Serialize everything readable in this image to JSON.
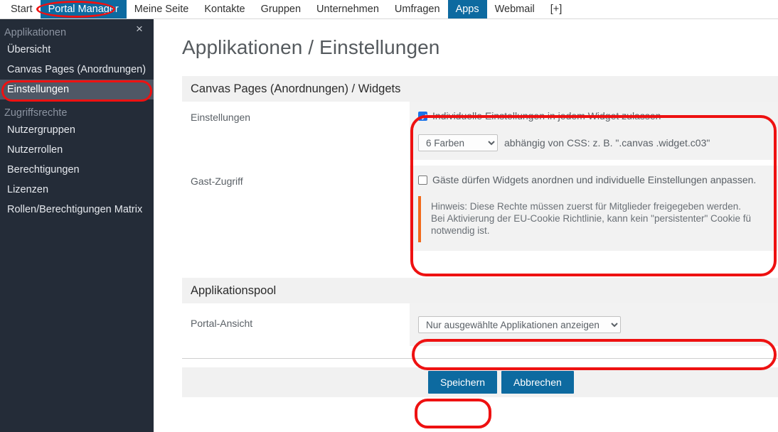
{
  "topnav": {
    "items": [
      {
        "label": "Start",
        "active": false
      },
      {
        "label": "Portal Manager",
        "active": true
      },
      {
        "label": "Meine Seite",
        "active": false
      },
      {
        "label": "Kontakte",
        "active": false
      },
      {
        "label": "Gruppen",
        "active": false
      },
      {
        "label": "Unternehmen",
        "active": false
      },
      {
        "label": "Umfragen",
        "active": false
      },
      {
        "label": "Apps",
        "active": true
      },
      {
        "label": "Webmail",
        "active": false
      },
      {
        "label": "[+]",
        "active": false
      }
    ]
  },
  "sidebar": {
    "close_icon": "×",
    "groups": [
      {
        "title": "Applikationen",
        "items": [
          {
            "label": "Übersicht",
            "active": false
          },
          {
            "label": "Canvas Pages (Anordnungen)",
            "active": false
          },
          {
            "label": "Einstellungen",
            "active": true
          }
        ]
      },
      {
        "title": "Zugriffsrechte",
        "items": [
          {
            "label": "Nutzergruppen",
            "active": false
          },
          {
            "label": "Nutzerrollen",
            "active": false
          },
          {
            "label": "Berechtigungen",
            "active": false
          },
          {
            "label": "Lizenzen",
            "active": false
          },
          {
            "label": "Rollen/Berechtigungen Matrix",
            "active": false
          }
        ]
      }
    ]
  },
  "main": {
    "page_title": "Applikationen / Einstellungen",
    "section1": {
      "header": "Canvas Pages (Anordnungen) / Widgets",
      "row_settings": {
        "label": "Einstellungen",
        "checkbox_label": "Individuelle Einstellungen in jedem Widget zulassen",
        "checkbox_checked": true,
        "select_value": "6 Farben",
        "select_options": [
          "6 Farben"
        ],
        "select_suffix": "abhängig von CSS: z. B. \".canvas .widget.c03\""
      },
      "row_guest": {
        "label": "Gast-Zugriff",
        "checkbox_label": "Gäste dürfen Widgets anordnen und individuelle Einstellungen anpassen.",
        "checkbox_checked": false,
        "hint_line1": "Hinweis: Diese Rechte müssen zuerst für Mitglieder freigegeben werden.",
        "hint_line2": "Bei Aktivierung der EU-Cookie Richtlinie, kann kein \"persistenter\" Cookie fü",
        "hint_line3": "notwendig ist."
      }
    },
    "section2": {
      "header": "Applikationspool",
      "row_portal": {
        "label": "Portal-Ansicht",
        "select_value": "Nur ausgewählte Applikationen anzeigen",
        "select_options": [
          "Nur ausgewählte Applikationen anzeigen"
        ]
      }
    },
    "footer": {
      "save_label": "Speichern",
      "cancel_label": "Abbrechen"
    }
  },
  "annotations": {
    "highlight_color": "#ee1111",
    "accent_color": "#0d6aa0",
    "hint_accent_color": "#f26a1b"
  }
}
